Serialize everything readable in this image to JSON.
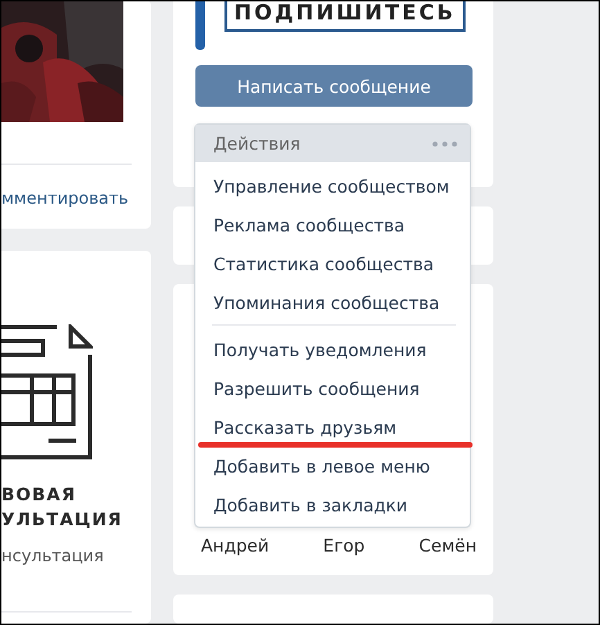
{
  "left_column": {
    "post": {
      "comment_link": "мментировать"
    },
    "promo": {
      "title_lines": [
        "ВОВАЯ",
        "УЛЬТАЦИЯ"
      ],
      "subtitle": "нсультация"
    }
  },
  "group": {
    "banner": "ПОДПИШИТЕСЬ",
    "message_button": "Написать сообщение",
    "actions": {
      "title": "Действия",
      "sections": [
        [
          {
            "label": "Управление сообществом",
            "underlined": false
          },
          {
            "label": "Реклама сообщества",
            "underlined": false
          },
          {
            "label": "Статистика сообщества",
            "underlined": false
          },
          {
            "label": "Упоминания сообщества",
            "underlined": false
          }
        ],
        [
          {
            "label": "Получать уведомления",
            "underlined": false
          },
          {
            "label": "Разрешить сообщения",
            "underlined": false
          },
          {
            "label": "Рассказать друзьям",
            "underlined": true
          },
          {
            "label": "Добавить в левое меню",
            "underlined": false
          },
          {
            "label": "Добавить в закладки",
            "underlined": false
          }
        ]
      ]
    },
    "friends": [
      "Андрей",
      "Егор",
      "Семён"
    ]
  }
}
